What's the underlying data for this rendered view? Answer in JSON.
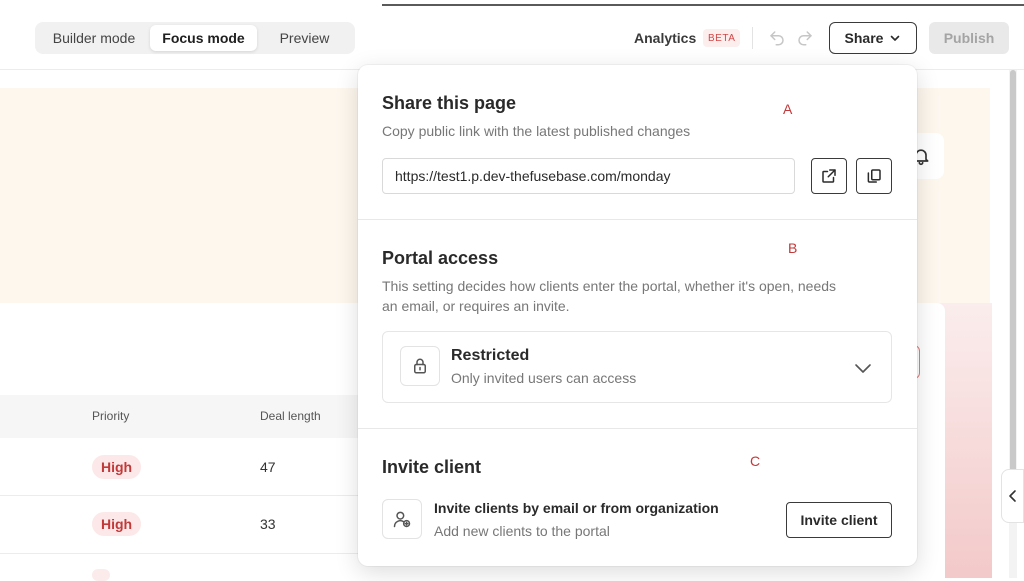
{
  "modes": {
    "builder": "Builder mode",
    "focus": "Focus mode",
    "preview": "Preview",
    "active": "Focus mode"
  },
  "toolbar": {
    "analytics": "Analytics",
    "beta": "BETA",
    "share": "Share",
    "publish": "Publish"
  },
  "table": {
    "columns": [
      "Priority",
      "Deal length"
    ],
    "rows": [
      {
        "priority": "High",
        "deal_length": "47"
      },
      {
        "priority": "High",
        "deal_length": "33"
      }
    ]
  },
  "share_popover": {
    "share_section": {
      "title": "Share this page",
      "subtitle": "Copy public link with the latest published changes",
      "url": "https://test1.p.dev-thefusebase.com/monday",
      "marker": "A"
    },
    "portal_access": {
      "title": "Portal access",
      "description_line1": "This setting decides how clients enter the portal, whether it's open, needs",
      "description_line2": "an email, or requires an invite.",
      "selected_title": "Restricted",
      "selected_subtitle": "Only invited users can access",
      "marker": "B"
    },
    "invite": {
      "title": "Invite client",
      "row_title": "Invite clients by email or from organization",
      "row_subtitle": "Add new clients to the portal",
      "button": "Invite client",
      "marker": "C"
    }
  },
  "colors": {
    "accent_red": "#c23939",
    "badge_bg": "#fce8e8",
    "banner_bg": "#fdf7ee"
  },
  "icons": [
    "undo-icon",
    "redo-icon",
    "chevron-down-icon",
    "external-link-icon",
    "copy-icon",
    "lock-icon",
    "add-user-icon",
    "bell-icon",
    "chevron-left-icon"
  ]
}
